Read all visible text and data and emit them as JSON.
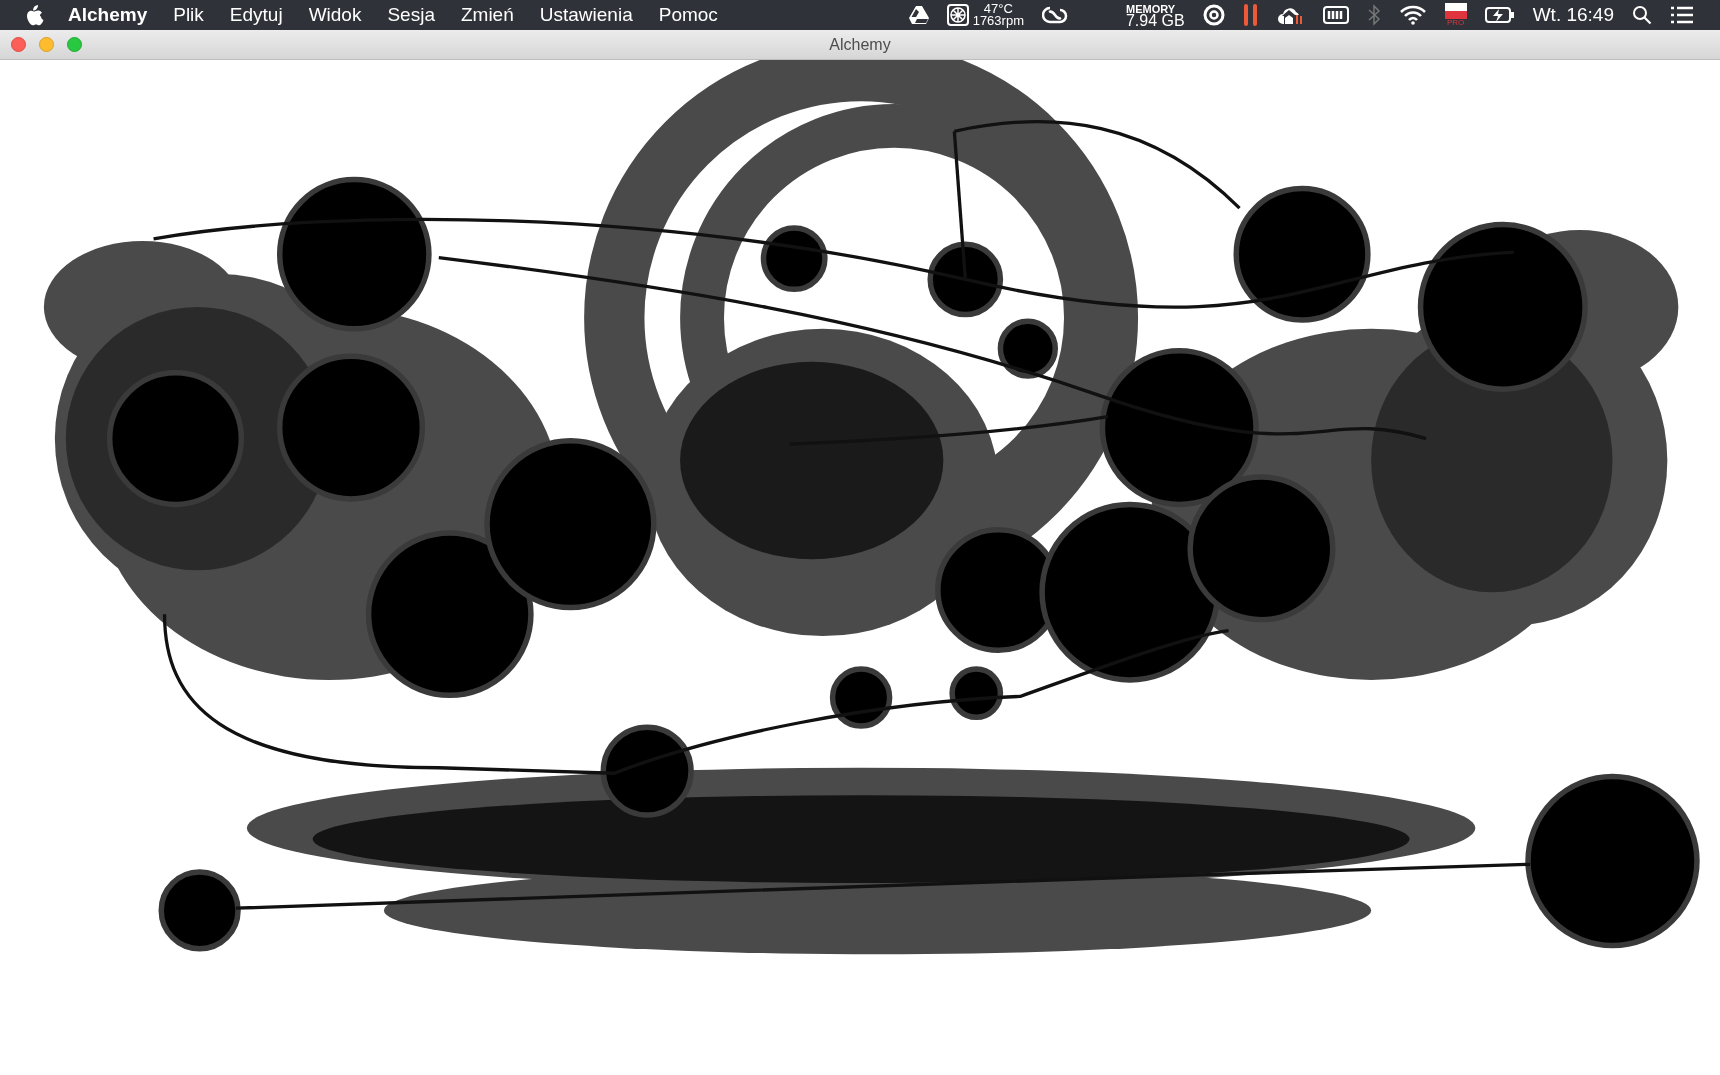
{
  "menu_bar": {
    "app_name": "Alchemy",
    "menus": [
      "Plik",
      "Edytuj",
      "Widok",
      "Sesja",
      "Zmień",
      "Ustawienia",
      "Pomoc"
    ],
    "status": {
      "temperature": "47°C",
      "fan_speed": "1763rpm",
      "memory_label": "MEMORY",
      "memory_value": "7.94 GB",
      "flag_badge": "PRO",
      "clock": "Wt. 16:49"
    }
  },
  "window": {
    "title": "Alchemy"
  }
}
